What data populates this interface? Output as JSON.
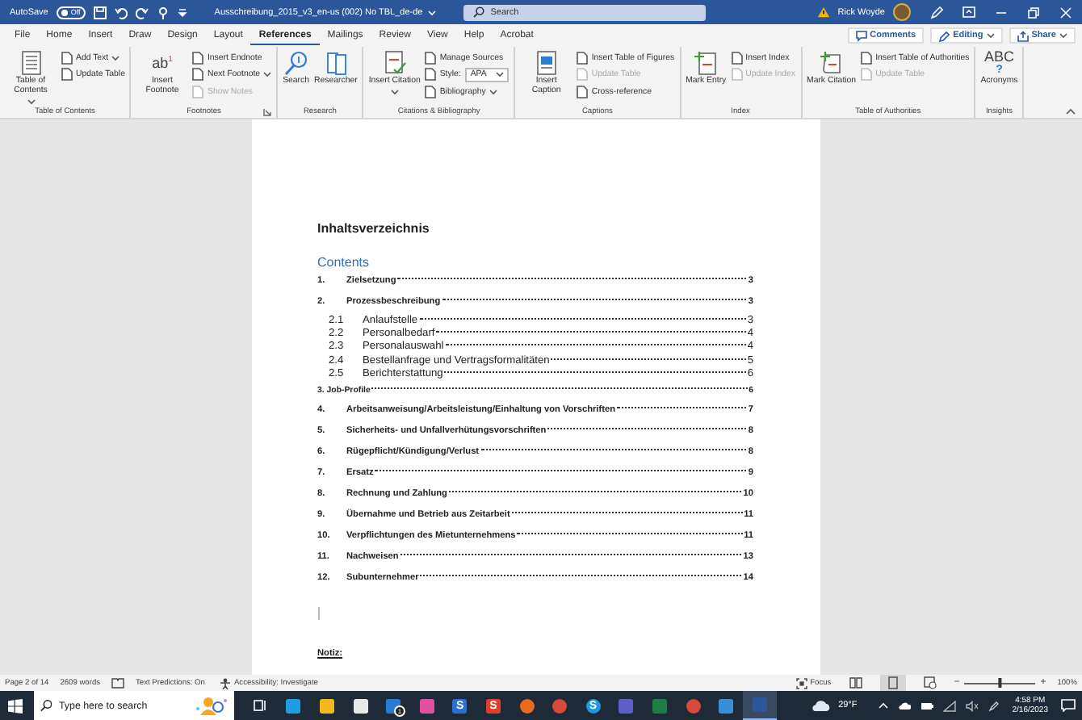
{
  "title_bar": {
    "autosave_label": "AutoSave",
    "autosave_state": "Off",
    "autosave_on": false,
    "document_title": "Ausschreibung_2015_v3_en-us (002) No TBL_de-de",
    "search": {
      "placeholder": "Search"
    },
    "user_name": "Rick Woyde"
  },
  "tabs": [
    {
      "label": "File",
      "selected": false
    },
    {
      "label": "Home",
      "selected": false
    },
    {
      "label": "Insert",
      "selected": false
    },
    {
      "label": "Draw",
      "selected": false
    },
    {
      "label": "Design",
      "selected": false
    },
    {
      "label": "Layout",
      "selected": false
    },
    {
      "label": "References",
      "selected": true
    },
    {
      "label": "Mailings",
      "selected": false
    },
    {
      "label": "Review",
      "selected": false
    },
    {
      "label": "View",
      "selected": false
    },
    {
      "label": "Help",
      "selected": false
    },
    {
      "label": "Acrobat",
      "selected": false
    }
  ],
  "header_buttons": [
    {
      "label": "Comments",
      "kind": "comments"
    },
    {
      "label": "Editing",
      "kind": "editing"
    },
    {
      "label": "Share",
      "kind": "share"
    }
  ],
  "ribbon_groups": [
    {
      "label": "Table of Contents",
      "launcher": false,
      "columns": [
        {
          "kind": "large",
          "label": "Table of Contents",
          "dropdown": true
        },
        {
          "kind": "stack",
          "items": [
            {
              "label": "Add Text",
              "dropdown": true,
              "disabled": false
            },
            {
              "label": "Update Table",
              "dropdown": false,
              "disabled": false
            }
          ]
        }
      ]
    },
    {
      "label": "Footnotes",
      "launcher": true,
      "columns": [
        {
          "kind": "large",
          "label": "Insert Footnote",
          "glyph": "ab$^{1}$",
          "dropdown": false
        },
        {
          "kind": "stack",
          "items": [
            {
              "label": "Insert Endnote",
              "dropdown": false,
              "disabled": false
            },
            {
              "label": "Next Footnote",
              "dropdown": true,
              "disabled": false
            },
            {
              "label": "Show Notes",
              "dropdown": false,
              "disabled": true
            }
          ]
        }
      ]
    },
    {
      "label": "Research",
      "launcher": false,
      "columns": [
        {
          "kind": "large",
          "label": "Search",
          "dropdown": false
        },
        {
          "kind": "large",
          "label": "Researcher",
          "dropdown": false
        }
      ]
    },
    {
      "label": "Citations & Bibliography",
      "launcher": false,
      "columns": [
        {
          "kind": "large",
          "label": "Insert Citation",
          "dropdown": true
        },
        {
          "kind": "stack",
          "items": [
            {
              "label": "Manage Sources",
              "dropdown": false,
              "disabled": false
            },
            {
              "label": "Style:",
              "value": "APA",
              "dropdown": true,
              "disabled": false,
              "kind": "select"
            },
            {
              "label": "Bibliography",
              "dropdown": true,
              "disabled": false
            }
          ]
        }
      ]
    },
    {
      "label": "Captions",
      "launcher": false,
      "columns": [
        {
          "kind": "large",
          "label": "Insert Caption",
          "dropdown": false
        },
        {
          "kind": "stack",
          "items": [
            {
              "label": "Insert Table of Figures",
              "dropdown": false,
              "disabled": false
            },
            {
              "label": "Update Table",
              "dropdown": false,
              "disabled": true
            },
            {
              "label": "Cross-reference",
              "dropdown": false,
              "disabled": false
            }
          ]
        }
      ]
    },
    {
      "label": "Index",
      "launcher": false,
      "columns": [
        {
          "kind": "large",
          "label": "Mark Entry",
          "dropdown": false
        },
        {
          "kind": "stack",
          "items": [
            {
              "label": "Insert Index",
              "dropdown": false,
              "disabled": false
            },
            {
              "label": "Update Index",
              "dropdown": false,
              "disabled": true
            }
          ]
        }
      ]
    },
    {
      "label": "Table of Authorities",
      "launcher": false,
      "columns": [
        {
          "kind": "large",
          "label": "Mark Citation",
          "dropdown": false
        },
        {
          "kind": "stack",
          "items": [
            {
              "label": "Insert Table of Authorities",
              "dropdown": false,
              "disabled": false
            },
            {
              "label": "Update Table",
              "dropdown": false,
              "disabled": true
            }
          ]
        }
      ]
    },
    {
      "label": "Insights",
      "launcher": false,
      "columns": [
        {
          "kind": "large",
          "label": "Acronyms",
          "glyph": "ABC",
          "glyph_mark": "?",
          "dropdown": false
        }
      ]
    }
  ],
  "document": {
    "heading": "Inhaltsverzeichnis",
    "toc_title": "Contents",
    "toc": [
      {
        "kind": "main",
        "number": "1.",
        "title": "Zielsetzung",
        "page": "3"
      },
      {
        "kind": "main",
        "number": "2.",
        "title": "Prozessbeschreibung",
        "page": "3",
        "children": [
          {
            "kind": "sub",
            "number": "2.1",
            "title": "Anlaufstelle",
            "page": "3"
          },
          {
            "kind": "sub",
            "number": "2.2",
            "title": "Personalbedarf",
            "page": "4"
          },
          {
            "kind": "sub",
            "number": "2.3",
            "title": "Personalauswahl",
            "page": "4"
          },
          {
            "kind": "sub",
            "number": "2.4",
            "title": "Bestellanfrage und Vertragsformalitäten",
            "page": "5"
          },
          {
            "kind": "sub",
            "number": "2.5",
            "title": "Berichterstattung",
            "page": "6"
          }
        ]
      },
      {
        "kind": "inline",
        "number": "3.",
        "title": "Job-Profile",
        "page": "6"
      },
      {
        "kind": "main",
        "number": "4.",
        "title": "Arbeitsanweisung/Arbeitsleistung/Einhaltung von Vorschriften",
        "page": "7"
      },
      {
        "kind": "main",
        "number": "5.",
        "title": "Sicherheits- und Unfallverhütungsvorschriften",
        "page": "8"
      },
      {
        "kind": "main",
        "number": "6.",
        "title": "Rügepflicht/Kündigung/Verlust",
        "page": "8"
      },
      {
        "kind": "main",
        "number": "7.",
        "title": "Ersatz",
        "page": "9"
      },
      {
        "kind": "main",
        "number": "8.",
        "title": "Rechnung und Zahlung",
        "page": "10"
      },
      {
        "kind": "main",
        "number": "9.",
        "title": "Übernahme und Betrieb aus Zeitarbeit",
        "page": "11"
      },
      {
        "kind": "main",
        "number": "10.",
        "title": "Verpflichtungen des Mietunternehmens",
        "page": "11"
      },
      {
        "kind": "main",
        "number": "11.",
        "title": "Nachweisen",
        "page": "13"
      },
      {
        "kind": "main",
        "number": "12.",
        "title": "Subunternehmer",
        "page": "14"
      }
    ],
    "note": "Notiz:"
  },
  "status_bar": {
    "page": "Page 2 of 14",
    "words": "2609 words",
    "predictions": "Text Predictions: On",
    "accessibility": "Accessibility: Investigate",
    "focus": "Focus",
    "views": [
      {
        "kind": "read",
        "selected": false
      },
      {
        "kind": "print",
        "selected": true
      },
      {
        "kind": "web",
        "selected": false
      }
    ],
    "zoom": {
      "minus": "−",
      "plus": "+",
      "level": 0.5,
      "reading": "100%"
    }
  },
  "taskbar": {
    "search": {
      "placeholder": "Type here to search"
    },
    "apps": [
      {
        "kind": "taskview"
      },
      {
        "kind": "app",
        "color": "#1f9be0"
      },
      {
        "kind": "app",
        "color": "#f2b91c"
      },
      {
        "kind": "app",
        "color": "#e8e8e8"
      },
      {
        "kind": "mail",
        "color": "#2a7bd4",
        "badge": "1"
      },
      {
        "kind": "app",
        "color": "#e04fa0"
      },
      {
        "kind": "app",
        "color": "#2d6fd1",
        "glyph": "S"
      },
      {
        "kind": "app",
        "color": "#e0402b",
        "glyph": "S"
      },
      {
        "kind": "round",
        "color": "#e86a1c"
      },
      {
        "kind": "round",
        "color": "#d64a3a"
      },
      {
        "kind": "round",
        "color": "#1a9ae0",
        "glyph": "S"
      },
      {
        "kind": "app",
        "color": "#5b5fc7"
      },
      {
        "kind": "app",
        "color": "#1e7e45"
      },
      {
        "kind": "round",
        "color": "#d64a3a"
      },
      {
        "kind": "app",
        "color": "#3a8ed8"
      },
      {
        "kind": "app",
        "color": "#2b579a",
        "selected": true
      }
    ],
    "weather": "29°F",
    "time": "4:58 PM",
    "date": "2/16/2023"
  }
}
